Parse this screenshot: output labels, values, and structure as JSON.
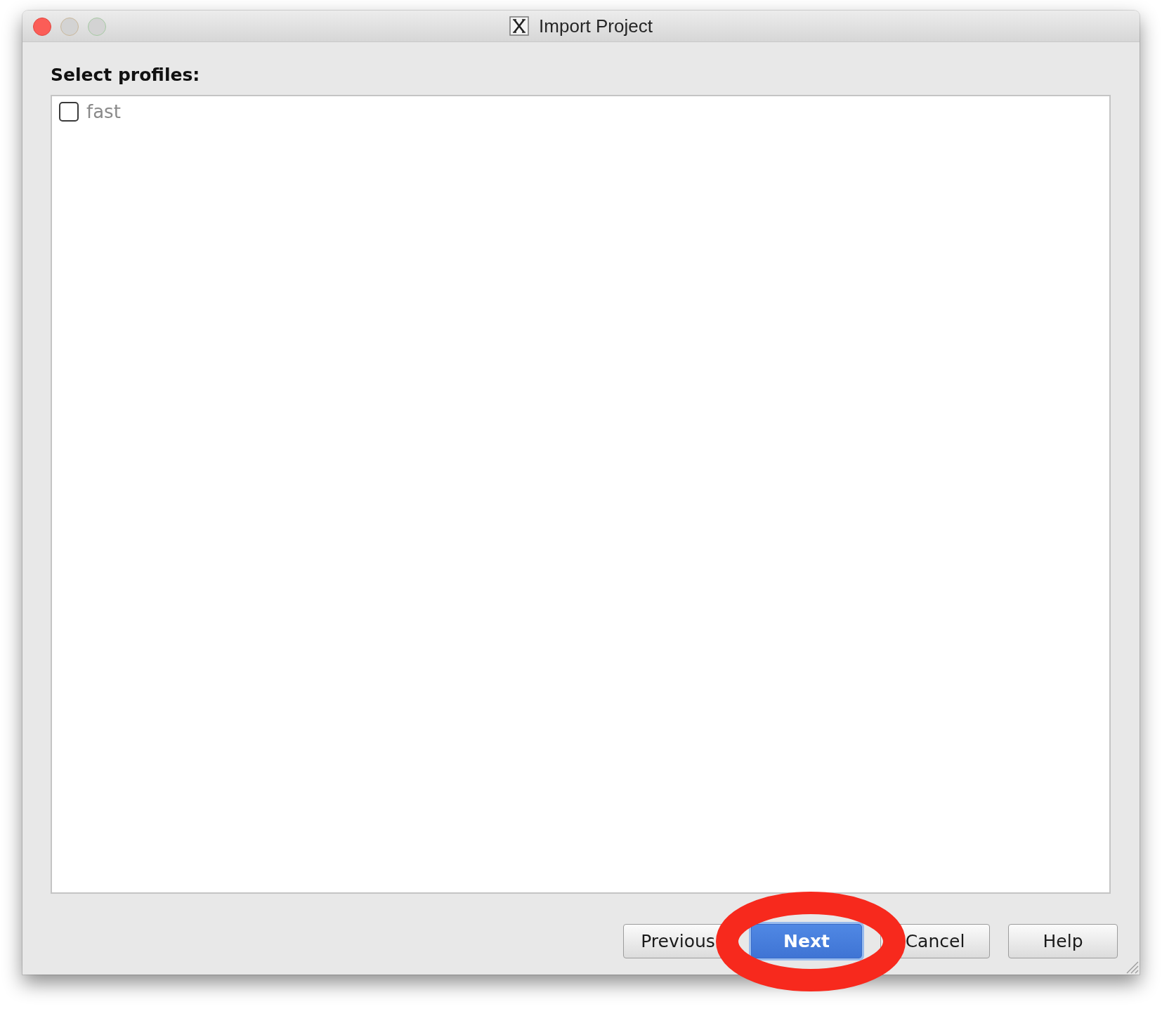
{
  "window": {
    "title": "Import Project"
  },
  "profiles": {
    "label": "Select profiles:",
    "items": [
      {
        "label": "fast",
        "checked": false
      }
    ]
  },
  "buttons": [
    {
      "label": "Previous",
      "default": false,
      "circled": false
    },
    {
      "label": "Next",
      "default": true,
      "circled": true
    },
    {
      "label": "Cancel",
      "default": false,
      "circled": false
    },
    {
      "label": "Help",
      "default": false,
      "circled": false
    }
  ]
}
